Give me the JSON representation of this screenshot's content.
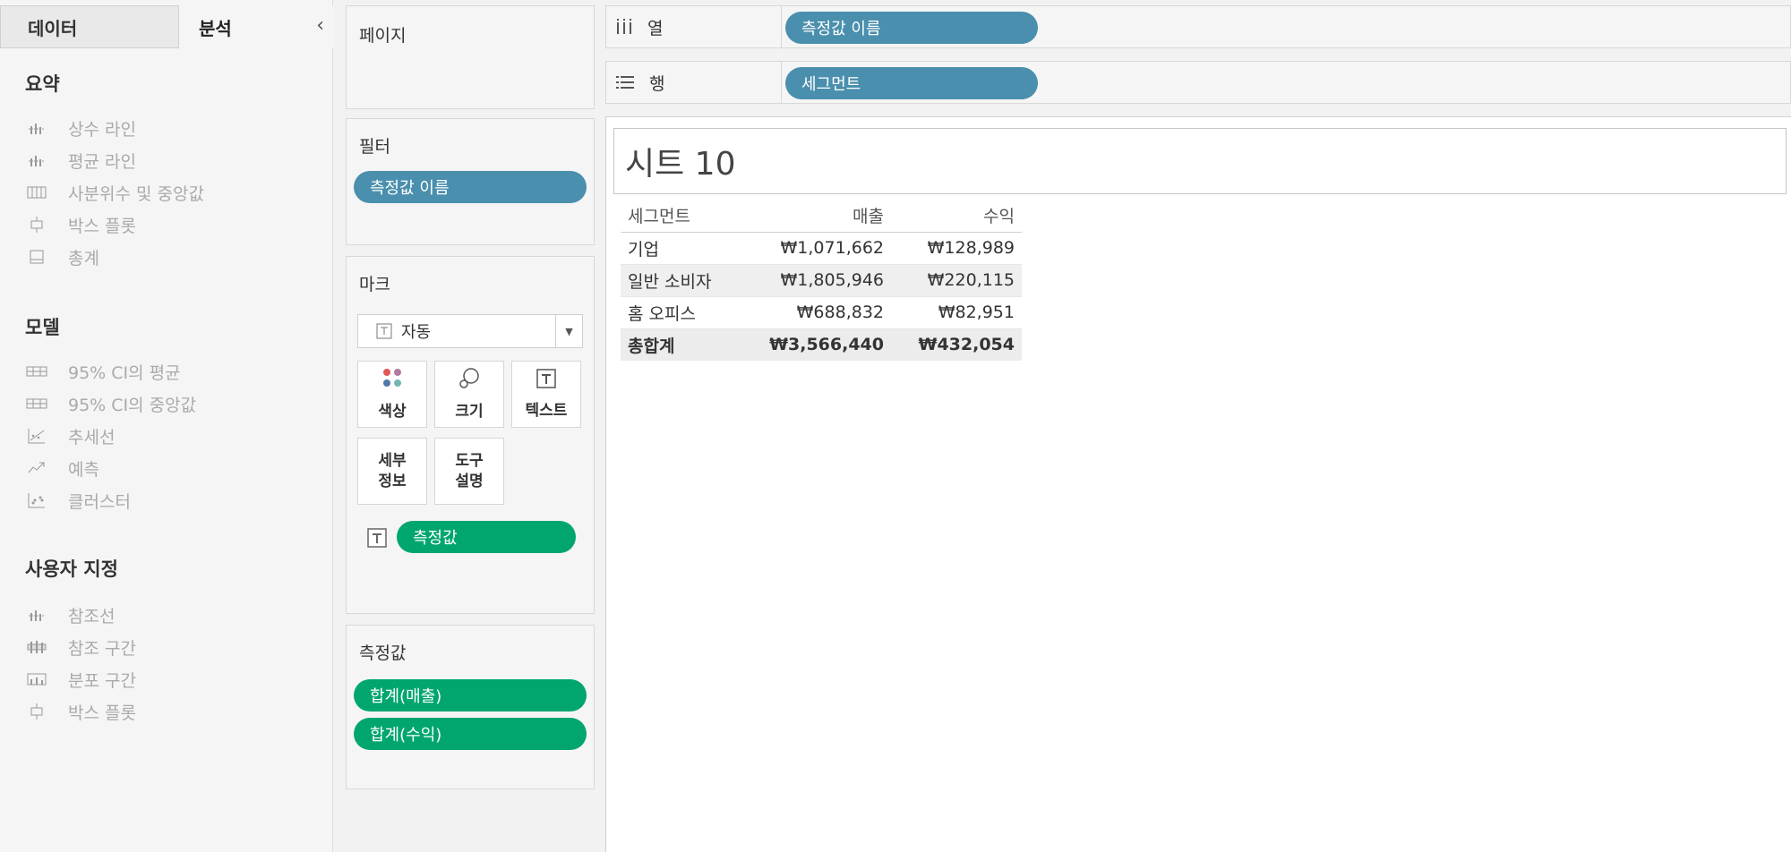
{
  "left_pane": {
    "tabs": {
      "data": "데이터",
      "analysis": "분석"
    },
    "summary": {
      "title": "요약",
      "items": [
        "상수 라인",
        "평균 라인",
        "사분위수 및 중앙값",
        "박스 플롯",
        "총계"
      ]
    },
    "model": {
      "title": "모델",
      "items": [
        "95% CI의 평균",
        "95% CI의 중앙값",
        "추세선",
        "예측",
        "클러스터"
      ]
    },
    "custom": {
      "title": "사용자 지정",
      "items": [
        "참조선",
        "참조 구간",
        "분포 구간",
        "박스 플롯"
      ]
    }
  },
  "pages": {
    "title": "페이지"
  },
  "filters": {
    "title": "필터",
    "pill": "측정값 이름"
  },
  "marks": {
    "title": "마크",
    "type": "자동",
    "buttons": {
      "color": "색상",
      "size": "크기",
      "text": "텍스트",
      "detail_line1": "세부",
      "detail_line2": "정보",
      "tooltip_line1": "도구",
      "tooltip_line2": "설명"
    },
    "pill": "측정값"
  },
  "measure_values": {
    "title": "측정값",
    "pills": [
      "합계(매출)",
      "합계(수익)"
    ]
  },
  "columns_shelf": {
    "label": "열",
    "pill": "측정값 이름"
  },
  "rows_shelf": {
    "label": "행",
    "pill": "세그먼트"
  },
  "view": {
    "title": "시트 10",
    "headers": [
      "세그먼트",
      "매출",
      "수익"
    ],
    "rows": [
      [
        "기업",
        "₩1,071,662",
        "₩128,989"
      ],
      [
        "일반 소비자",
        "₩1,805,946",
        "₩220,115"
      ],
      [
        "홈 오피스",
        "₩688,832",
        "₩82,951"
      ]
    ],
    "total": [
      "총합계",
      "₩3,566,440",
      "₩432,054"
    ]
  },
  "colors": {
    "dimension_pill": "#4a8fad",
    "measure_pill": "#00a66e"
  }
}
